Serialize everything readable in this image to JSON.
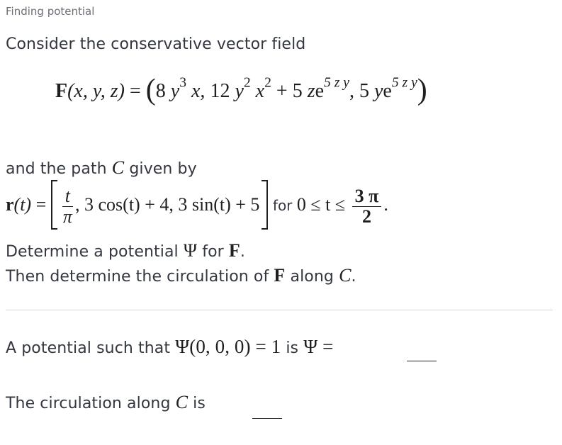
{
  "title": "Finding potential",
  "intro": "Consider the conservative vector field",
  "field": {
    "lhs": "F",
    "args": "(x, y, z)",
    "equals": "=",
    "comp1_coef": "8",
    "comp1_var": "y",
    "comp1_exp": "3",
    "comp1_rest": "x,",
    "comp2_coef": "12",
    "comp2_var1": "y",
    "comp2_exp1": "2",
    "comp2_var2": "x",
    "comp2_exp2": "2",
    "comp2_plus": "+ 5",
    "comp2_z": "z",
    "e": "e",
    "exp_text": "5 z y",
    "comp3_coef": ", 5",
    "comp3_var": "y"
  },
  "path_intro": {
    "before": "and the path",
    "var": "C",
    "after": "given by"
  },
  "path": {
    "lhs": "r",
    "arg": "(t)",
    "equals": "=",
    "frac_num": "t",
    "frac_den": "π",
    "rest": ", 3 cos(t) + 4, 3 sin(t) + 5",
    "for_label": "for",
    "range": "0 ≤ t ≤",
    "bound_num": "3 π",
    "bound_den": "2",
    "period": "."
  },
  "task1": {
    "before": "Determine a potential",
    "psi": "Ψ",
    "mid": "for",
    "F": "F",
    "end": "."
  },
  "task2": {
    "before": "Then determine the circulation of",
    "F": "F",
    "mid": "along",
    "C": "C",
    "end": "."
  },
  "question1": {
    "before": "A potential such that",
    "expr": "Ψ(0, 0, 0) = 1",
    "mid": "is",
    "psi_eq": "Ψ =",
    "answer": ""
  },
  "question2": {
    "before": "The circulation along",
    "var": "C",
    "after": "is",
    "answer": ""
  }
}
